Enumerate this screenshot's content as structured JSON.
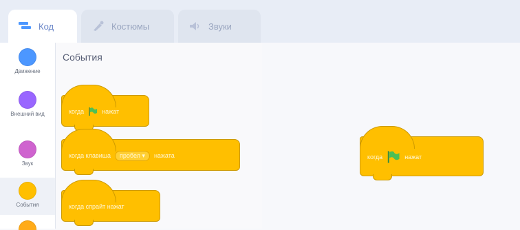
{
  "tabs": [
    {
      "label": "Код",
      "icon": "code-icon",
      "active": true
    },
    {
      "label": "Костюмы",
      "icon": "brush-icon",
      "active": false
    },
    {
      "label": "Звуки",
      "icon": "speaker-icon",
      "active": false
    }
  ],
  "categories": [
    {
      "label": "Движение",
      "color": "#4c97ff"
    },
    {
      "label": "Внешний вид",
      "color": "#9966ff"
    },
    {
      "label": "Звук",
      "color": "#cf63cf"
    },
    {
      "label": "События",
      "color": "#ffbf00",
      "selected": true
    },
    {
      "label": "",
      "color": "#ffab19"
    }
  ],
  "palette": {
    "section_title": "События",
    "blocks": [
      {
        "pre": "когда",
        "flag": true,
        "post": "нажат"
      },
      {
        "pre": "когда клавиша",
        "dropdown": "пробел ▾",
        "post": "нажата"
      },
      {
        "pre": "когда спрайт нажат"
      }
    ]
  },
  "workspace": {
    "blocks": [
      {
        "pre": "когда",
        "flag": true,
        "post": "нажат"
      }
    ]
  },
  "colors": {
    "events": "#ffbf00",
    "flag": "#4cbf56",
    "accent": "#4c97ff"
  }
}
